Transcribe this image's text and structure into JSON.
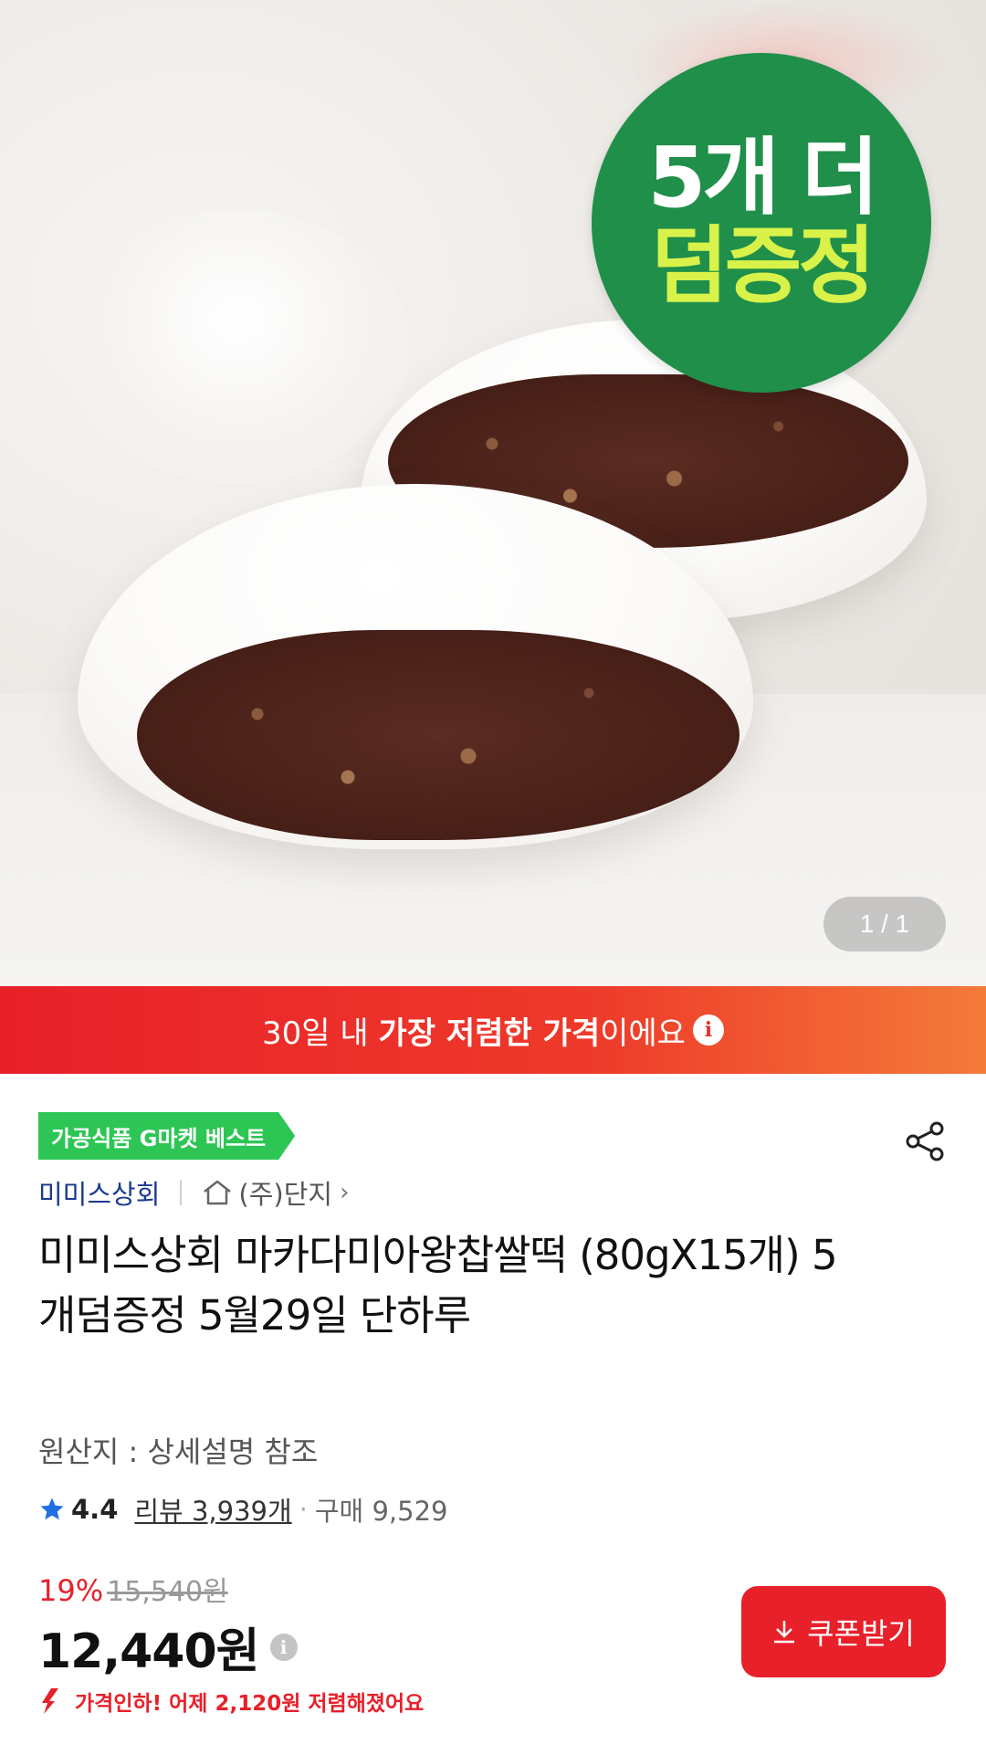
{
  "hero": {
    "badge_line1": "5개 더",
    "badge_line2": "덤증정",
    "image_counter": "1 / 1"
  },
  "promo": {
    "prefix": "30일 내 ",
    "highlight": "가장 저렴한 가격",
    "suffix": "이에요",
    "info_icon_glyph": "i"
  },
  "product": {
    "category_tag": "가공식품 G마켓 베스트",
    "seller_name": "미미스상회",
    "store_name": "(주)단지",
    "store_chevron": "›",
    "title": "미미스상회 마카다미아왕찹쌀떡 (80gX15개) 5개덤증정 5월29일 단하루",
    "origin": "원산지 : 상세설명 참조",
    "rating": "4.4",
    "reviews": "리뷰 3,939개",
    "rating_dot": "·",
    "sales": "구매 9,529",
    "discount_rate": "19%",
    "original_price": "15,540원",
    "price": "12,440원",
    "price_info_glyph": "i",
    "coupon_label": "쿠폰받기",
    "price_drop_notice": "가격인하! 어제 2,120원 저렴해졌어요"
  },
  "colors": {
    "accent_red": "#e8202a",
    "badge_green": "#1f8f4a",
    "tag_green": "#2dc655",
    "seller_blue": "#1a3a8f",
    "star_blue": "#1f6fe5"
  },
  "icons": [
    "share-icon",
    "home-icon",
    "star-icon",
    "download-icon",
    "price-down-arrow-icon",
    "info-icon"
  ]
}
